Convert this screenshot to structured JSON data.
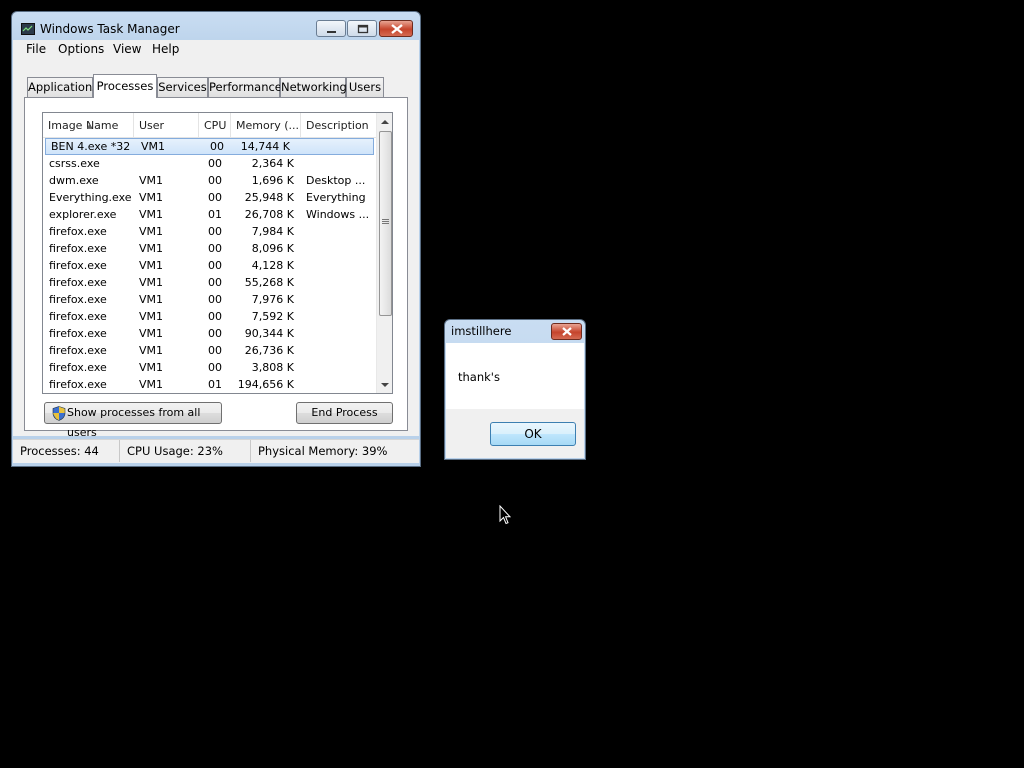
{
  "task_manager": {
    "title": "Windows Task Manager",
    "icon": "task-manager-app-icon",
    "menu": [
      "File",
      "Options",
      "View",
      "Help"
    ],
    "tabs": [
      "Applications",
      "Processes",
      "Services",
      "Performance",
      "Networking",
      "Users"
    ],
    "active_tab": "Processes",
    "columns": [
      "Image Name",
      "User Name",
      "CPU",
      "Memory (...",
      "Description"
    ],
    "sorted_column": "Image Name",
    "processes": [
      {
        "name": "BEN 4.exe *32",
        "user": "VM1",
        "cpu": "00",
        "memory": "14,744 K",
        "description": "",
        "selected": true
      },
      {
        "name": "csrss.exe",
        "user": "",
        "cpu": "00",
        "memory": "2,364 K",
        "description": ""
      },
      {
        "name": "dwm.exe",
        "user": "VM1",
        "cpu": "00",
        "memory": "1,696 K",
        "description": "Desktop ..."
      },
      {
        "name": "Everything.exe",
        "user": "VM1",
        "cpu": "00",
        "memory": "25,948 K",
        "description": "Everything"
      },
      {
        "name": "explorer.exe",
        "user": "VM1",
        "cpu": "01",
        "memory": "26,708 K",
        "description": "Windows ..."
      },
      {
        "name": "firefox.exe",
        "user": "VM1",
        "cpu": "00",
        "memory": "7,984 K",
        "description": ""
      },
      {
        "name": "firefox.exe",
        "user": "VM1",
        "cpu": "00",
        "memory": "8,096 K",
        "description": ""
      },
      {
        "name": "firefox.exe",
        "user": "VM1",
        "cpu": "00",
        "memory": "4,128 K",
        "description": ""
      },
      {
        "name": "firefox.exe",
        "user": "VM1",
        "cpu": "00",
        "memory": "55,268 K",
        "description": ""
      },
      {
        "name": "firefox.exe",
        "user": "VM1",
        "cpu": "00",
        "memory": "7,976 K",
        "description": ""
      },
      {
        "name": "firefox.exe",
        "user": "VM1",
        "cpu": "00",
        "memory": "7,592 K",
        "description": ""
      },
      {
        "name": "firefox.exe",
        "user": "VM1",
        "cpu": "00",
        "memory": "90,344 K",
        "description": ""
      },
      {
        "name": "firefox.exe",
        "user": "VM1",
        "cpu": "00",
        "memory": "26,736 K",
        "description": ""
      },
      {
        "name": "firefox.exe",
        "user": "VM1",
        "cpu": "00",
        "memory": "3,808 K",
        "description": ""
      },
      {
        "name": "firefox.exe",
        "user": "VM1",
        "cpu": "01",
        "memory": "194,656 K",
        "description": ""
      }
    ],
    "show_all_button": "Show processes from all users",
    "end_process_button": "End Process",
    "status": {
      "processes": "Processes: 44",
      "cpu_usage": "CPU Usage: 23%",
      "physical_memory": "Physical Memory: 39%"
    }
  },
  "message_box": {
    "title": "imstillhere",
    "message": "thank's",
    "ok_button": "OK"
  },
  "colors": {
    "desktop": "#000000",
    "title_bar": "#b9d1ea",
    "selection": "#cfe4fa",
    "close_button": "#c6442c"
  }
}
